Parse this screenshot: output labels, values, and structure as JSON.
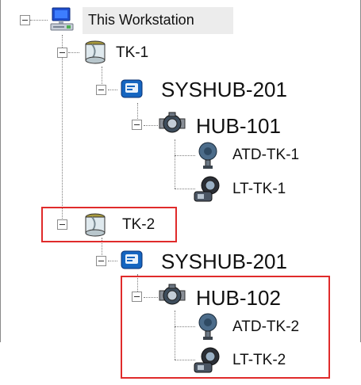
{
  "tree": {
    "root": {
      "label": "This Workstation",
      "icon": "computer-icon"
    },
    "nodes": [
      {
        "label": "TK-1",
        "icon": "tank-icon",
        "expanded": true
      },
      {
        "label": "SYSHUB-201",
        "icon": "system-hub-icon",
        "expanded": true
      },
      {
        "label": "HUB-101",
        "icon": "hub-device-icon",
        "expanded": true
      },
      {
        "label": "ATD-TK-1",
        "icon": "temperature-transmitter-icon"
      },
      {
        "label": "LT-TK-1",
        "icon": "level-transmitter-icon"
      },
      {
        "label": "TK-2",
        "icon": "tank-icon",
        "expanded": true,
        "highlighted": true
      },
      {
        "label": "SYSHUB-201",
        "icon": "system-hub-icon",
        "expanded": true
      },
      {
        "label": "HUB-102",
        "icon": "hub-device-icon",
        "expanded": true,
        "highlighted": true
      },
      {
        "label": "ATD-TK-2",
        "icon": "temperature-transmitter-icon"
      },
      {
        "label": "LT-TK-2",
        "icon": "level-transmitter-icon"
      }
    ]
  },
  "colors": {
    "highlight_border": "#e02b2b",
    "tree_lines": "#7d7d7d",
    "selection_bg": "#ececec"
  }
}
